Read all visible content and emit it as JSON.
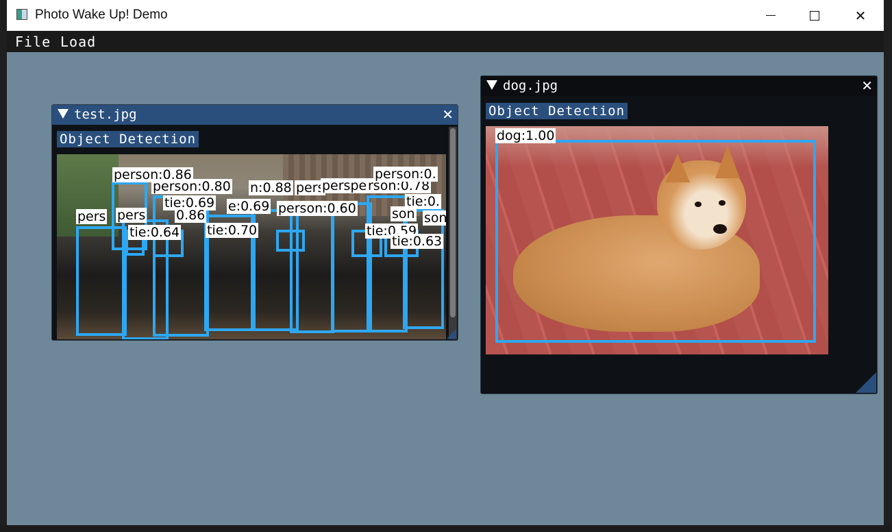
{
  "window": {
    "title": "Photo Wake Up! Demo"
  },
  "menu": {
    "file": "File",
    "load": "Load"
  },
  "panel1": {
    "title": "test.jpg",
    "section": "Object Detection",
    "labels": [
      "person:0.86",
      "person:0.80",
      "n:0.88",
      "pers",
      "perspe",
      "rson:0.78",
      "person:0.",
      "tie:0.69",
      "e:0.69",
      "person:0.60",
      "tie:0.",
      "pers",
      "pers",
      "0.86",
      "son",
      "tie:0.64",
      "tie:0.70",
      "tie:0.59",
      "son",
      "tie:0.63"
    ]
  },
  "panel2": {
    "title": "dog.jpg",
    "section": "Object Detection",
    "labels": [
      "dog:1.00"
    ]
  },
  "colors": {
    "bbox": "#2ea7f2",
    "header_active": "#2a4f7d",
    "background": "#6f8899"
  }
}
